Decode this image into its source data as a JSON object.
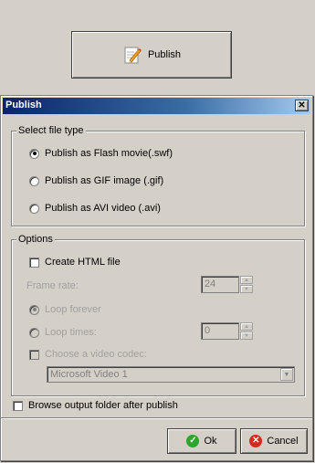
{
  "top_button": {
    "label": "Publish",
    "icon": "pencil-paper-icon"
  },
  "dialog": {
    "title": "Publish",
    "close_glyph": "✕",
    "file_type": {
      "legend": "Select file type",
      "options": [
        {
          "label": "Publish as Flash movie(.swf)",
          "checked": true
        },
        {
          "label": "Publish as GIF image (.gif)",
          "checked": false
        },
        {
          "label": "Publish as AVI video (.avi)",
          "checked": false
        }
      ]
    },
    "options": {
      "legend": "Options",
      "create_html": {
        "label": "Create HTML file",
        "checked": false
      },
      "frame_rate": {
        "label": "Frame rate:",
        "value": "24"
      },
      "loop_forever": {
        "label": "Loop forever",
        "checked": true
      },
      "loop_times": {
        "label": "Loop times:",
        "value": "0"
      },
      "video_codec": {
        "label": "Choose a video codec:",
        "checked": false
      },
      "codec_select": {
        "value": "Microsoft Video 1"
      }
    },
    "browse_output": {
      "label": "Browse output folder after publish",
      "checked": false
    },
    "ok_button": {
      "label": "Ok",
      "icon": "check-circle-icon",
      "color": "#2fa52f"
    },
    "cancel_button": {
      "label": "Cancel",
      "icon": "x-circle-icon",
      "color": "#d9281c"
    }
  }
}
